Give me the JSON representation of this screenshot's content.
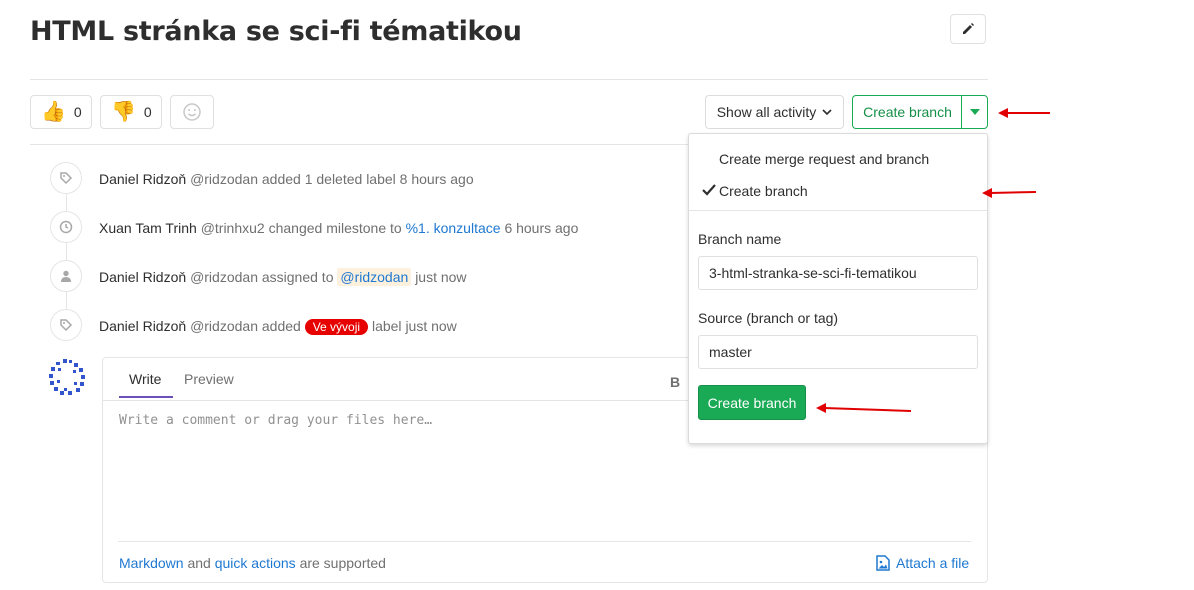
{
  "issue": {
    "title": "HTML stránka se sci-fi tématikou"
  },
  "awards": {
    "thumbs_up_count": "0",
    "thumbs_down_count": "0"
  },
  "toolbar": {
    "activity_filter": "Show all activity",
    "create_branch_label": "Create branch"
  },
  "timeline": [
    {
      "icon": "tag-icon",
      "author": "Daniel Ridzoň",
      "handle": "@ridzodan",
      "action": "added 1 deleted label",
      "time": "8 hours ago"
    },
    {
      "icon": "clock-icon",
      "author": "Xuan Tam Trinh",
      "handle": "@trinhxu2",
      "action": "changed milestone to",
      "link": "%1. konzultace",
      "time": "6 hours ago"
    },
    {
      "icon": "user-icon",
      "author": "Daniel Ridzoň",
      "handle": "@ridzodan",
      "action": "assigned to",
      "mention": "@ridzodan",
      "time": "just now"
    },
    {
      "icon": "tag-icon",
      "author": "Daniel Ridzoň",
      "handle": "@ridzodan",
      "action": "added",
      "label": "Ve vývoji",
      "action_suffix": "label",
      "time": "just now"
    }
  ],
  "comment": {
    "tab_write": "Write",
    "tab_preview": "Preview",
    "bold": "B",
    "placeholder": "Write a comment or drag your files here…",
    "footer_markdown": "Markdown",
    "footer_and": "and",
    "footer_quick_actions": "quick actions",
    "footer_supported": "are supported",
    "attach": "Attach a file"
  },
  "dropdown": {
    "option_mr": "Create merge request and branch",
    "option_branch": "Create branch",
    "branch_name_label": "Branch name",
    "branch_name_value": "3-html-stranka-se-sci-fi-tematikou",
    "source_label": "Source (branch or tag)",
    "source_value": "master",
    "submit": "Create branch"
  },
  "colors": {
    "accent_green": "#1aaa55",
    "link_blue": "#1f78d1",
    "label_red": "#e60000",
    "annotation_arrow": "#e00000"
  }
}
